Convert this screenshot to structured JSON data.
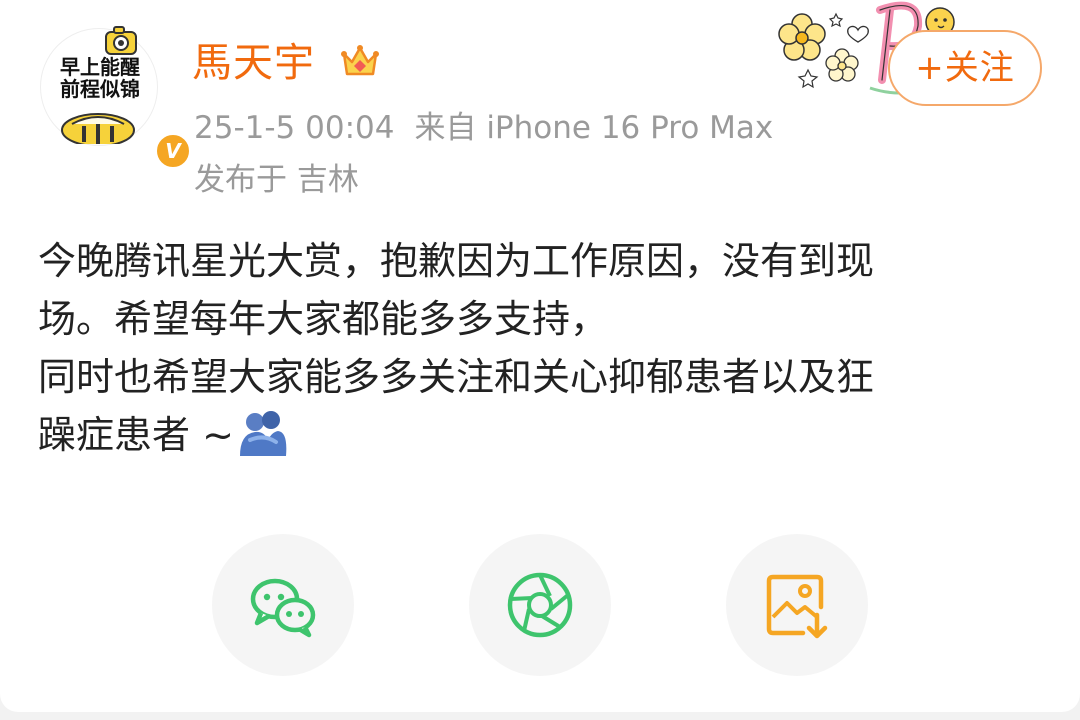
{
  "post": {
    "avatar": {
      "text_line1": "早上能醒",
      "text_line2": "前程似锦",
      "badge": "V"
    },
    "author": {
      "name": "馬天宇",
      "badge_icon": "crown-icon"
    },
    "time": "25-1-5 00:04",
    "source": "来自 iPhone 16 Pro Max",
    "location": "发布于 吉林",
    "follow_label": "+关注",
    "content_lines": [
      "今晚腾讯星光大赏，抱歉因为工作原因，没有到现",
      "场。希望每年大家都能多多支持，",
      "同时也希望大家能多多关注和关心抑郁患者以及狂",
      "躁症患者 ~"
    ],
    "content_emoji": "people-hugging-emoji"
  },
  "share": {
    "buttons": [
      {
        "name": "wechat-share",
        "icon": "wechat-icon",
        "color": "#3ec46d"
      },
      {
        "name": "moments-share",
        "icon": "moments-aperture-icon",
        "color": "#3ec46d"
      },
      {
        "name": "save-image",
        "icon": "save-image-icon",
        "color": "#f5a623"
      }
    ]
  },
  "colors": {
    "accent": "#f16a0e",
    "meta": "#9a9a9a",
    "text": "#222222",
    "green": "#3ec46d"
  }
}
